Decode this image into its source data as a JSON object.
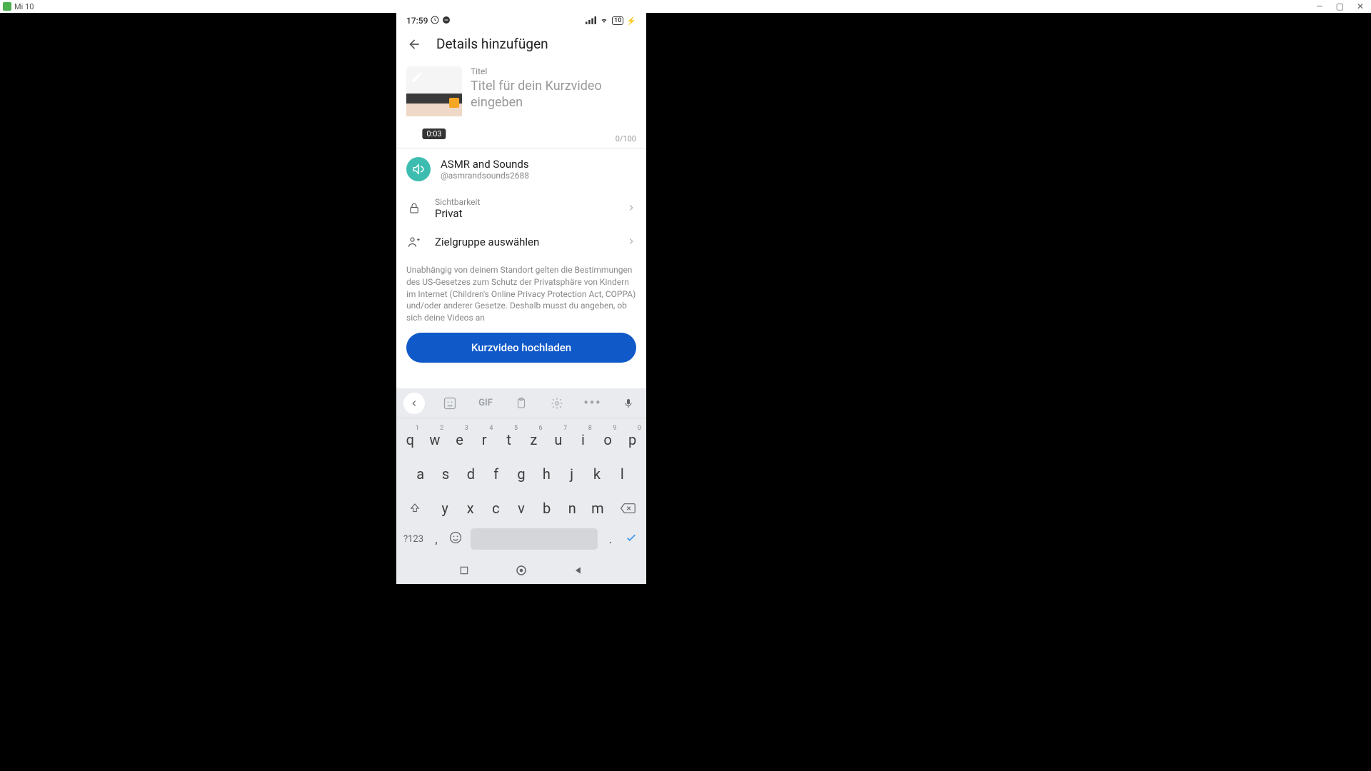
{
  "window": {
    "title": "Mi 10",
    "controls": {
      "min": "—",
      "max": "▢",
      "close": "✕"
    }
  },
  "status_bar": {
    "time": "17:59",
    "battery": "10"
  },
  "header": {
    "title": "Details hinzufügen"
  },
  "title_section": {
    "duration": "0:03",
    "label": "Titel",
    "placeholder": "Titel für dein Kurzvideo eingeben",
    "char_count": "0/100"
  },
  "channel": {
    "name": "ASMR and Sounds",
    "handle": "@asmrandsounds2688"
  },
  "visibility": {
    "label": "Sichtbarkeit",
    "value": "Privat"
  },
  "audience": {
    "label": "Zielgruppe auswählen"
  },
  "disclaimer": "Unabhängig von deinem Standort gelten die Bestimmungen des US-Gesetzes zum Schutz der Privatsphäre von Kindern im Internet (Children's Online Privacy Protection Act, COPPA) und/oder anderer Gesetze. Deshalb musst du angeben, ob sich deine Videos an",
  "upload_button": "Kurzvideo hochladen",
  "keyboard": {
    "gif_label": "GIF",
    "row1": [
      {
        "k": "q",
        "n": "1"
      },
      {
        "k": "w",
        "n": "2"
      },
      {
        "k": "e",
        "n": "3"
      },
      {
        "k": "r",
        "n": "4"
      },
      {
        "k": "t",
        "n": "5"
      },
      {
        "k": "z",
        "n": "6"
      },
      {
        "k": "u",
        "n": "7"
      },
      {
        "k": "i",
        "n": "8"
      },
      {
        "k": "o",
        "n": "9"
      },
      {
        "k": "p",
        "n": "0"
      }
    ],
    "row2": [
      "a",
      "s",
      "d",
      "f",
      "g",
      "h",
      "j",
      "k",
      "l"
    ],
    "row3": [
      "y",
      "x",
      "c",
      "v",
      "b",
      "n",
      "m"
    ],
    "sym_label": "?123",
    "comma": ",",
    "period": "."
  }
}
